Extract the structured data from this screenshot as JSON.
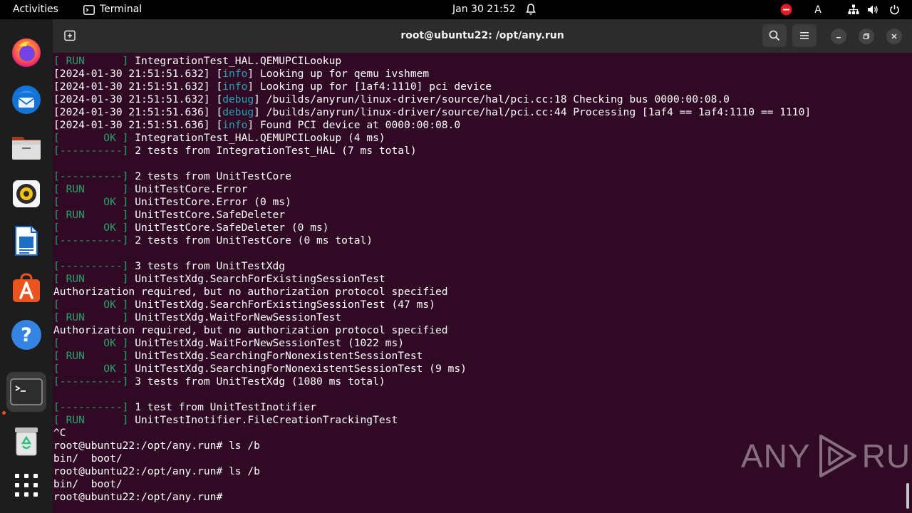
{
  "topbar": {
    "activities": "Activities",
    "app_name": "Terminal",
    "clock": "Jan 30  21:52",
    "keyboard_indicator": "A"
  },
  "dock": {
    "apps": [
      {
        "name": "Firefox",
        "icon": "firefox-icon"
      },
      {
        "name": "Thunderbird",
        "icon": "thunderbird-icon"
      },
      {
        "name": "Files",
        "icon": "files-icon"
      },
      {
        "name": "Rhythmbox",
        "icon": "rhythmbox-icon"
      },
      {
        "name": "LibreOffice Writer",
        "icon": "writer-icon"
      },
      {
        "name": "Ubuntu Software",
        "icon": "software-icon"
      },
      {
        "name": "Help",
        "icon": "help-icon"
      },
      {
        "name": "Terminal",
        "icon": "terminal-icon"
      },
      {
        "name": "Trash",
        "icon": "trash-icon"
      },
      {
        "name": "Show Applications",
        "icon": "app-grid-icon"
      }
    ]
  },
  "window": {
    "title": "root@ubuntu22: /opt/any.run"
  },
  "terminal": {
    "lines": [
      [
        {
          "t": "[ RUN      ]",
          "c": "g"
        },
        {
          "t": " IntegrationTest_HAL.QEMUPCILookup"
        }
      ],
      [
        {
          "t": "[2024-01-30 21:51:51.632] ["
        },
        {
          "t": "info",
          "c": "c"
        },
        {
          "t": "] Looking up for qemu ivshmem"
        }
      ],
      [
        {
          "t": "[2024-01-30 21:51:51.632] ["
        },
        {
          "t": "info",
          "c": "c"
        },
        {
          "t": "] Looking up for [1af4:1110] pci device"
        }
      ],
      [
        {
          "t": "[2024-01-30 21:51:51.632] ["
        },
        {
          "t": "debug",
          "c": "c"
        },
        {
          "t": "] /builds/anyrun/linux-driver/source/hal/pci.cc:18 Checking bus 0000:00:08.0"
        }
      ],
      [
        {
          "t": "[2024-01-30 21:51:51.636] ["
        },
        {
          "t": "debug",
          "c": "c"
        },
        {
          "t": "] /builds/anyrun/linux-driver/source/hal/pci.cc:44 Processing [1af4 == 1af4:1110 == 1110]"
        }
      ],
      [
        {
          "t": "[2024-01-30 21:51:51.636] ["
        },
        {
          "t": "info",
          "c": "c"
        },
        {
          "t": "] Found PCI device at 0000:00:08.0"
        }
      ],
      [
        {
          "t": "[       OK ]",
          "c": "g"
        },
        {
          "t": " IntegrationTest_HAL.QEMUPCILookup (4 ms)"
        }
      ],
      [
        {
          "t": "[----------]",
          "c": "g"
        },
        {
          "t": " 2 tests from IntegrationTest_HAL (7 ms total)"
        }
      ],
      [],
      [
        {
          "t": "[----------]",
          "c": "g"
        },
        {
          "t": " 2 tests from UnitTestCore"
        }
      ],
      [
        {
          "t": "[ RUN      ]",
          "c": "g"
        },
        {
          "t": " UnitTestCore.Error"
        }
      ],
      [
        {
          "t": "[       OK ]",
          "c": "g"
        },
        {
          "t": " UnitTestCore.Error (0 ms)"
        }
      ],
      [
        {
          "t": "[ RUN      ]",
          "c": "g"
        },
        {
          "t": " UnitTestCore.SafeDeleter"
        }
      ],
      [
        {
          "t": "[       OK ]",
          "c": "g"
        },
        {
          "t": " UnitTestCore.SafeDeleter (0 ms)"
        }
      ],
      [
        {
          "t": "[----------]",
          "c": "g"
        },
        {
          "t": " 2 tests from UnitTestCore (0 ms total)"
        }
      ],
      [],
      [
        {
          "t": "[----------]",
          "c": "g"
        },
        {
          "t": " 3 tests from UnitTestXdg"
        }
      ],
      [
        {
          "t": "[ RUN      ]",
          "c": "g"
        },
        {
          "t": " UnitTestXdg.SearchForExistingSessionTest"
        }
      ],
      [
        {
          "t": "Authorization required, but no authorization protocol specified"
        }
      ],
      [
        {
          "t": "[       OK ]",
          "c": "g"
        },
        {
          "t": " UnitTestXdg.SearchForExistingSessionTest (47 ms)"
        }
      ],
      [
        {
          "t": "[ RUN      ]",
          "c": "g"
        },
        {
          "t": " UnitTestXdg.WaitForNewSessionTest"
        }
      ],
      [
        {
          "t": "Authorization required, but no authorization protocol specified"
        }
      ],
      [
        {
          "t": "[       OK ]",
          "c": "g"
        },
        {
          "t": " UnitTestXdg.WaitForNewSessionTest (1022 ms)"
        }
      ],
      [
        {
          "t": "[ RUN      ]",
          "c": "g"
        },
        {
          "t": " UnitTestXdg.SearchingForNonexistentSessionTest"
        }
      ],
      [
        {
          "t": "[       OK ]",
          "c": "g"
        },
        {
          "t": " UnitTestXdg.SearchingForNonexistentSessionTest (9 ms)"
        }
      ],
      [
        {
          "t": "[----------]",
          "c": "g"
        },
        {
          "t": " 3 tests from UnitTestXdg (1080 ms total)"
        }
      ],
      [],
      [
        {
          "t": "[----------]",
          "c": "g"
        },
        {
          "t": " 1 test from UnitTestInotifier"
        }
      ],
      [
        {
          "t": "[ RUN      ]",
          "c": "g"
        },
        {
          "t": " UnitTestInotifier.FileCreationTrackingTest"
        }
      ],
      [
        {
          "t": "^C"
        }
      ],
      [
        {
          "t": "root@ubuntu22:/opt/any.run# ls /b"
        }
      ],
      [
        {
          "t": "bin/  boot/"
        }
      ],
      [
        {
          "t": "root@ubuntu22:/opt/any.run# ls /b"
        }
      ],
      [
        {
          "t": "bin/  boot/"
        }
      ],
      [
        {
          "t": "root@ubuntu22:/opt/any.run# "
        }
      ]
    ]
  },
  "watermark": {
    "left": "ANY",
    "right": "RUN"
  },
  "colors": {
    "terminal_bg": "#300a24",
    "green": "#26a269",
    "cyan": "#2aa1b3",
    "accent": "#e95420"
  }
}
